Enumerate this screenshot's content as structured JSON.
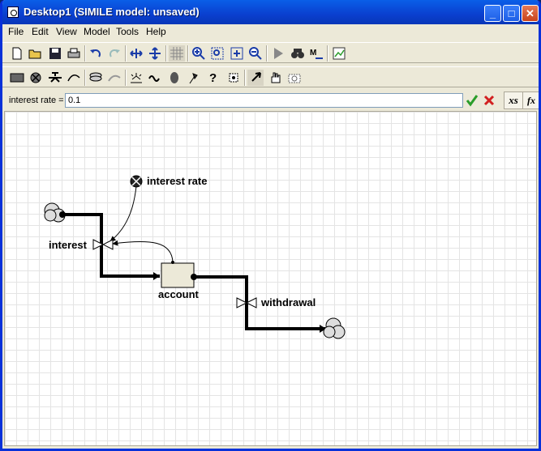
{
  "window": {
    "title": "Desktop1 (SIMILE model: unsaved)"
  },
  "title_buttons": {
    "minimize": "_",
    "maximize": "□",
    "close": "✕"
  },
  "menu": [
    {
      "label": "File"
    },
    {
      "label": "Edit"
    },
    {
      "label": "View"
    },
    {
      "label": "Model"
    },
    {
      "label": "Tools"
    },
    {
      "label": "Help"
    }
  ],
  "toolbar1": [
    "new-file-icon",
    "open-folder-icon",
    "save-icon",
    "print-icon",
    "undo-icon",
    "redo-icon",
    "move-horizontal-icon",
    "move-vertical-icon",
    "grid-icon",
    "zoom-in-icon",
    "zoom-fit-icon",
    "zoom-reset-icon",
    "zoom-out-icon",
    "run-icon",
    "find-icon",
    "rename-icon",
    "plot-icon"
  ],
  "toolbar2": [
    "compartment-icon",
    "cloud-icon",
    "flow-icon",
    "influence-icon",
    "submodel-icon",
    "role-arrow-icon",
    "event-icon",
    "variable-icon",
    "state-icon",
    "flag-icon",
    "help-icon",
    "sequence-icon",
    "pointer-icon",
    "hand-icon",
    "camera-icon"
  ],
  "equation_bar": {
    "label": "interest rate =",
    "value": "0.1",
    "accept_icon": "check-icon",
    "cancel_icon": "cross-icon",
    "xs_label": "xs",
    "fx_label": "fx"
  },
  "diagram": {
    "labels": {
      "interest_rate": "interest rate",
      "interest": "interest",
      "account": "account",
      "withdrawal": "withdrawal"
    }
  },
  "colors": {
    "titlebar": "#0a3fcf",
    "face": "#ece9d8",
    "accept": "#2a9d2a",
    "cancel": "#d22020"
  }
}
